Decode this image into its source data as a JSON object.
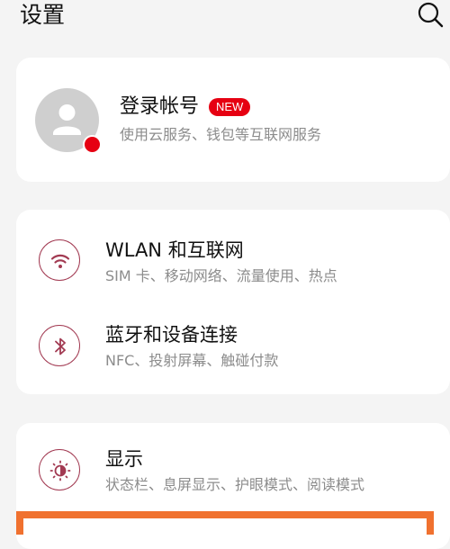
{
  "header": {
    "title": "设置",
    "search_icon": "search-icon"
  },
  "account": {
    "title": "登录帐号",
    "badge": "NEW",
    "subtitle": "使用云服务、钱包等互联网服务",
    "avatar_icon": "user-icon"
  },
  "network": {
    "items": [
      {
        "title": "WLAN 和互联网",
        "subtitle": "SIM 卡、移动网络、流量使用、热点",
        "icon": "wifi-icon"
      },
      {
        "title": "蓝牙和设备连接",
        "subtitle": "NFC、投射屏幕、触碰付款",
        "icon": "bluetooth-icon"
      }
    ]
  },
  "display": {
    "items": [
      {
        "title": "显示",
        "subtitle": "状态栏、息屏显示、护眼模式、阅读模式",
        "icon": "brightness-icon"
      }
    ]
  },
  "colors": {
    "accent": "#a23a52",
    "badge": "#e60012",
    "highlight": "#f0712f",
    "background": "#f4f4f4"
  }
}
